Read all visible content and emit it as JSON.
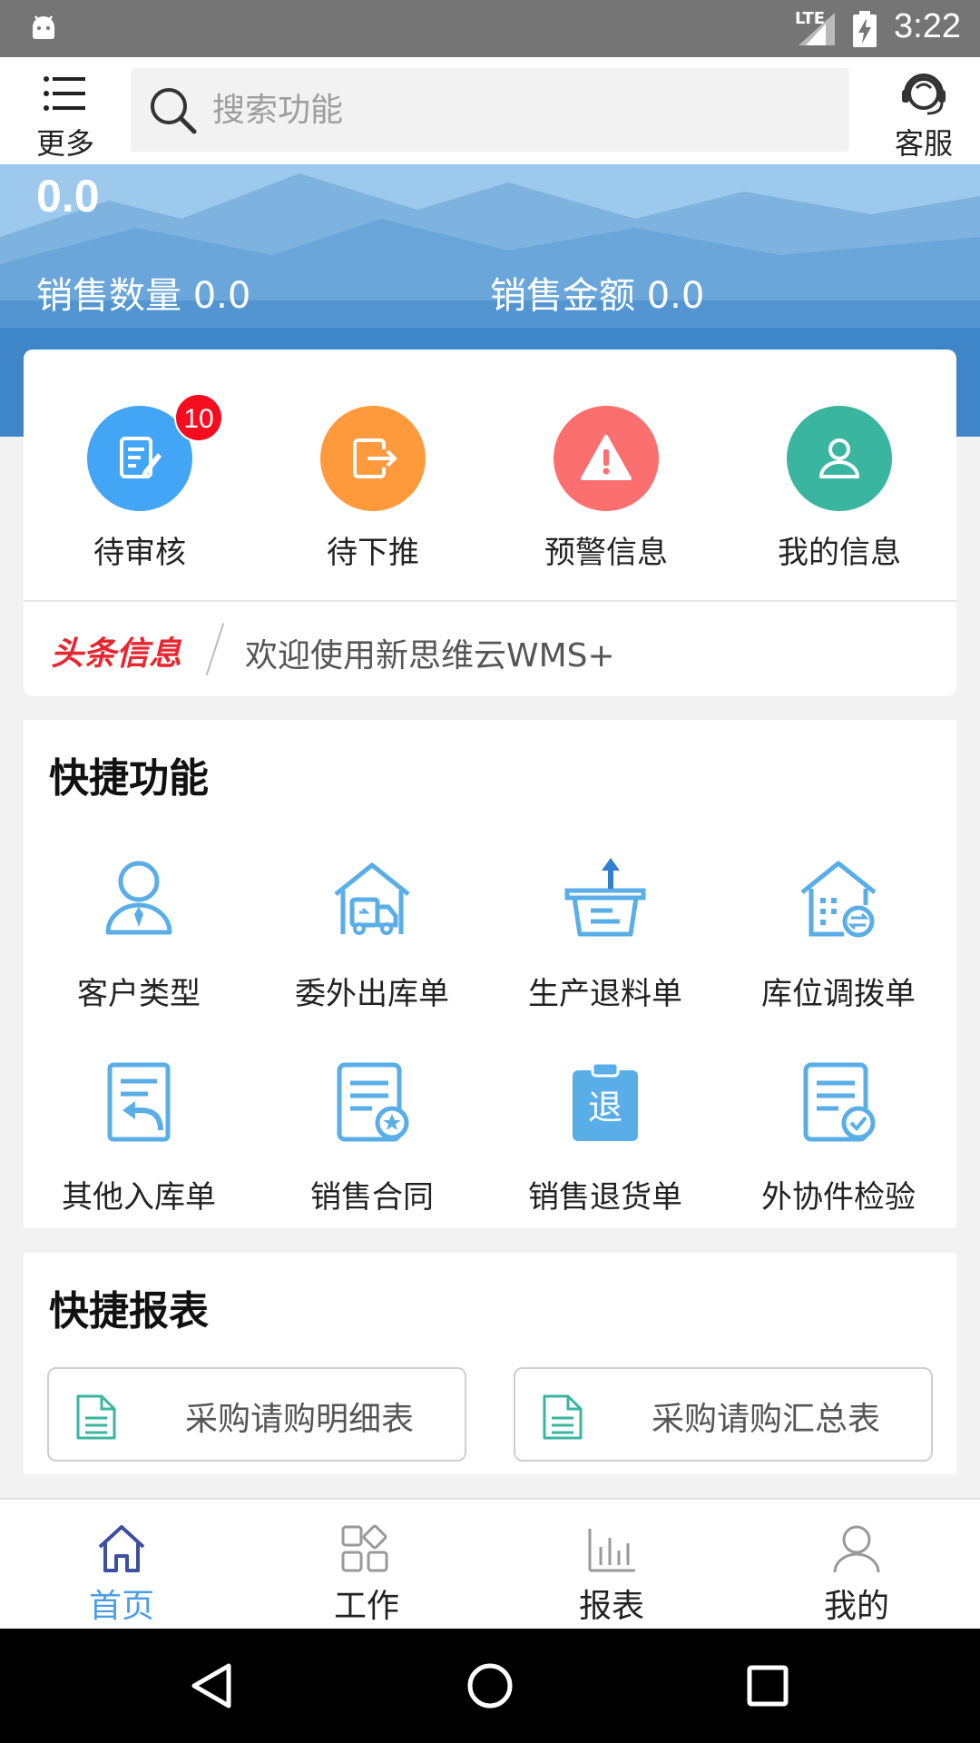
{
  "status_bar": {
    "network": "LTE",
    "time": "3:22"
  },
  "top_bar": {
    "more_label": "更多",
    "search_placeholder": "搜索功能",
    "service_label": "客服"
  },
  "banner": {
    "total": "0.0",
    "sales_qty_label": "销售数量 0.0",
    "sales_amount_label": "销售金额 0.0"
  },
  "quick_actions": [
    {
      "label": "待审核",
      "icon": "edit-document-icon",
      "color": "#42a5f5",
      "badge": "10"
    },
    {
      "label": "待下推",
      "icon": "export-icon",
      "color": "#ff9a3c"
    },
    {
      "label": "预警信息",
      "icon": "warning-icon",
      "color": "#fb6f6f"
    },
    {
      "label": "我的信息",
      "icon": "user-icon",
      "color": "#3ab5a0"
    }
  ],
  "headline": {
    "tag": "头条信息",
    "text": "欢迎使用新思维云WMS+"
  },
  "features": {
    "title": "快捷功能",
    "items": [
      {
        "label": "客户类型",
        "icon": "customer-icon"
      },
      {
        "label": "委外出库单",
        "icon": "truck-warehouse-icon"
      },
      {
        "label": "生产退料单",
        "icon": "return-box-icon"
      },
      {
        "label": "库位调拨单",
        "icon": "warehouse-transfer-icon"
      },
      {
        "label": "其他入库单",
        "icon": "document-return-icon"
      },
      {
        "label": "销售合同",
        "icon": "contract-star-icon"
      },
      {
        "label": "销售退货单",
        "icon": "return-clipboard-icon"
      },
      {
        "label": "外协件检验",
        "icon": "inspection-check-icon"
      }
    ]
  },
  "reports": {
    "title": "快捷报表",
    "items": [
      {
        "label": "采购请购明细表",
        "icon": "report-file-icon"
      },
      {
        "label": "采购请购汇总表",
        "icon": "report-file-icon"
      }
    ]
  },
  "bottom_nav": [
    {
      "label": "首页",
      "icon": "home-icon",
      "active": true
    },
    {
      "label": "工作",
      "icon": "apps-icon"
    },
    {
      "label": "报表",
      "icon": "bar-chart-icon"
    },
    {
      "label": "我的",
      "icon": "profile-icon"
    }
  ],
  "colors": {
    "accent": "#4a9ee8",
    "feature_icon": "#5aaee8",
    "headline": "#e8262f",
    "badge": "#f30d1f"
  }
}
